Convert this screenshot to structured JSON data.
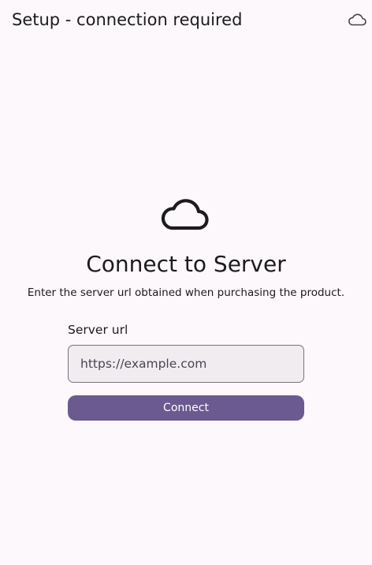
{
  "app_bar": {
    "title": "Setup - connection required",
    "status_icon": "cloud-icon"
  },
  "main": {
    "icon": "cloud-icon",
    "heading": "Connect to Server",
    "subtitle": "Enter the server url obtained when purchasing the product.",
    "server_url": {
      "label": "Server url",
      "value": "",
      "placeholder": "https://example.com"
    },
    "connect_label": "Connect"
  },
  "colors": {
    "background": "#fcf8fc",
    "primary": "#6a5a90",
    "field_fill": "#f0ecf0",
    "field_border": "#79747e",
    "text": "#1c1b1f"
  }
}
